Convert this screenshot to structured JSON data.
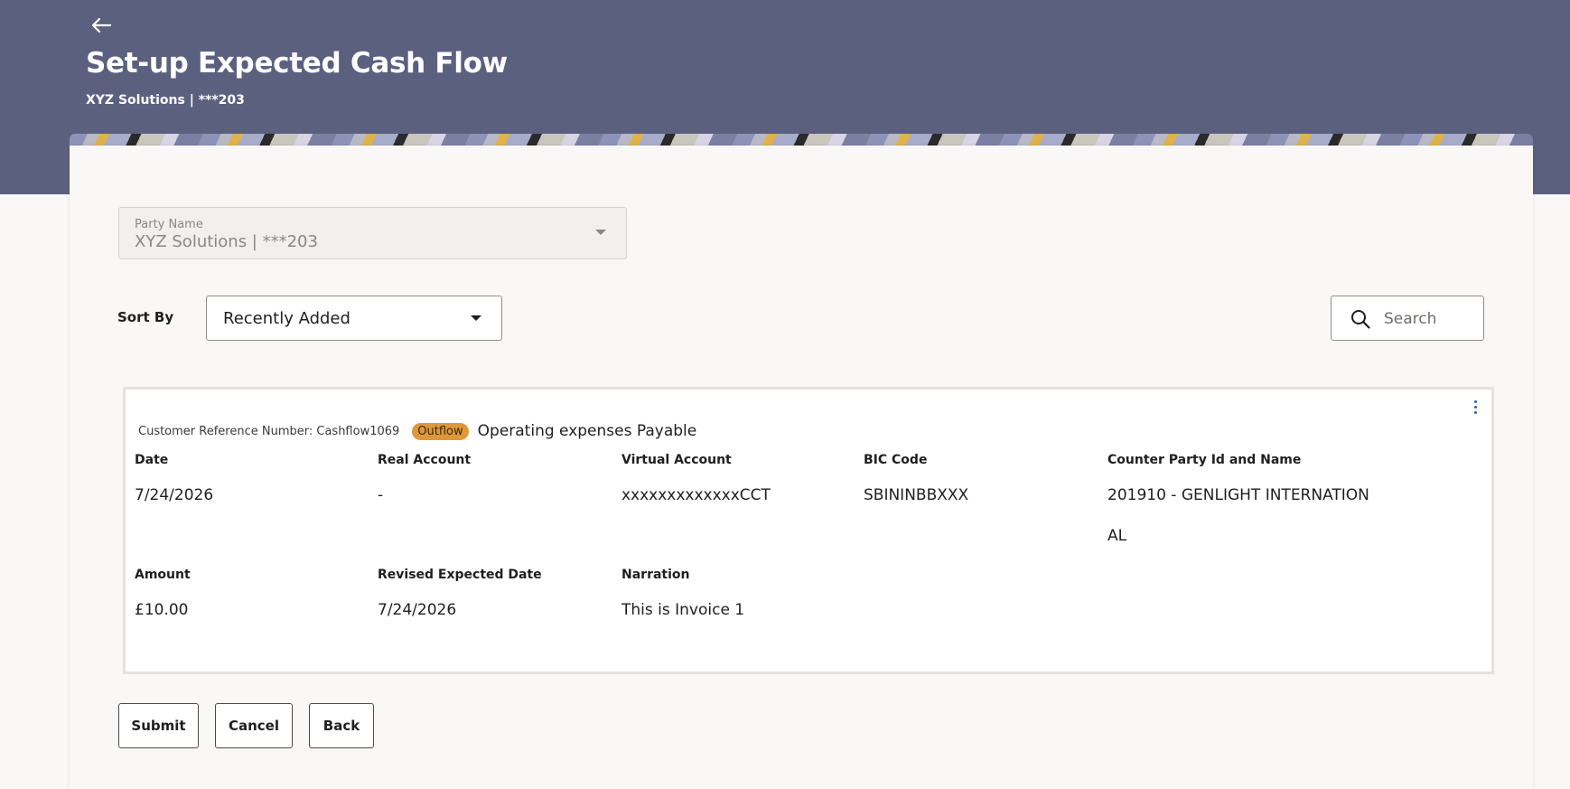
{
  "header": {
    "title": "Set-up Expected Cash Flow",
    "subtitle": "XYZ Solutions | ***203",
    "back_icon": "arrow-left-icon",
    "background_color": "#5c607f"
  },
  "party": {
    "label": "Party Name",
    "value": "XYZ Solutions | ***203"
  },
  "sort": {
    "label": "Sort By",
    "selected": "Recently Added"
  },
  "search": {
    "placeholder": "Search",
    "value": ""
  },
  "record": {
    "reference_text": "Customer Reference Number: Cashflow1069",
    "badge": "Outflow",
    "badge_color": "#e0973a",
    "title": "Operating expenses Payable",
    "fields": {
      "date": {
        "label": "Date",
        "value": "7/24/2026"
      },
      "real_account": {
        "label": "Real Account",
        "value": "-"
      },
      "virtual_account": {
        "label": "Virtual Account",
        "value": "xxxxxxxxxxxxxCCT"
      },
      "bic_code": {
        "label": "BIC Code",
        "value": "SBININBBXXX"
      },
      "counter_party": {
        "label": "Counter Party Id and Name",
        "value_line1": "201910 - GENLIGHT INTERNATION",
        "value_line2": "AL"
      },
      "amount": {
        "label": "Amount",
        "value": "£10.00"
      },
      "revised_date": {
        "label": "Revised Expected Date",
        "value": "7/24/2026"
      },
      "narration": {
        "label": "Narration",
        "value": "This is Invoice 1"
      }
    }
  },
  "actions": {
    "submit": "Submit",
    "cancel": "Cancel",
    "back": "Back"
  }
}
